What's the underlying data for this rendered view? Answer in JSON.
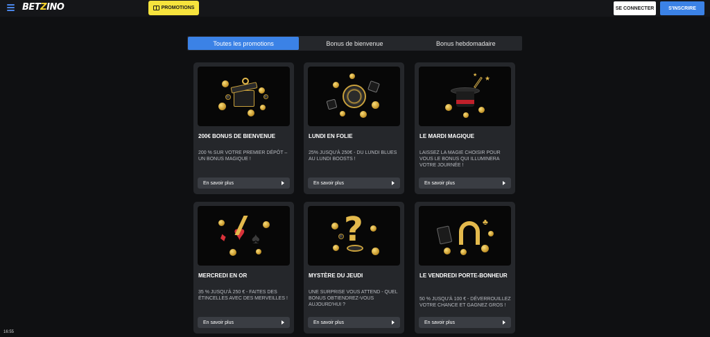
{
  "header": {
    "logo_text": "BETZINO",
    "logo_part1": "BET",
    "logo_part2": "Z",
    "logo_part3": "INO",
    "promotions_label": "PROMOTIONS",
    "login_label": "SE CONNECTER",
    "signup_label": "S'INSCRIRE"
  },
  "tabs": [
    {
      "label": "Toutes les promotions",
      "active": true
    },
    {
      "label": "Bonus de bienvenue",
      "active": false
    },
    {
      "label": "Bonus hebdomadaire",
      "active": false
    }
  ],
  "cards": [
    {
      "title": "200€ BONUS DE BIENVENUE",
      "description": "200 % SUR VOTRE PREMIER DÉPÔT – UN BONUS MAGIQUE !",
      "button_label": "En savoir plus",
      "image_icon": "gift-box-icon"
    },
    {
      "title": "LUNDI EN FOLIE",
      "description": "25% JUSQU'À 250€ - DU LUNDI BLUES AU LUNDI BOOSTS !",
      "button_label": "En savoir plus",
      "image_icon": "casino-chip-dice-icon"
    },
    {
      "title": "LE MARDI MAGIQUE",
      "description": "LAISSEZ LA MAGIE CHOISIR POUR VOUS LE BONUS QUI ILLUMINERA VOTRE JOURNÉE !",
      "button_label": "En savoir plus",
      "image_icon": "magic-hat-icon"
    },
    {
      "title": "MERCREDI EN OR",
      "description": "35 % JUSQU'À 250 € - FAITES DES ÉTINCELLES AVEC DES MERVEILLES !",
      "button_label": "En savoir plus",
      "image_icon": "card-suits-lightning-icon"
    },
    {
      "title": "MYSTÈRE DU JEUDI",
      "description": "UNE SURPRISE VOUS ATTEND - QUEL BONUS OBTIENDREZ-VOUS AUJOURD'HUI ?",
      "button_label": "En savoir plus",
      "image_icon": "question-mark-icon"
    },
    {
      "title": "LE VENDREDI PORTE-BONHEUR",
      "description": "50 % JUSQU'À 100 € - DÉVERROUILLEZ VOTRE CHANCE ET GAGNEZ GROS !",
      "button_label": "En savoir plus",
      "image_icon": "horseshoe-clover-icon"
    }
  ],
  "status": {
    "time": "16:55"
  },
  "colors": {
    "accent": "#3b82e6",
    "promo": "#f6e33d",
    "card_bg": "#25272b",
    "page_bg": "#0f1012"
  }
}
